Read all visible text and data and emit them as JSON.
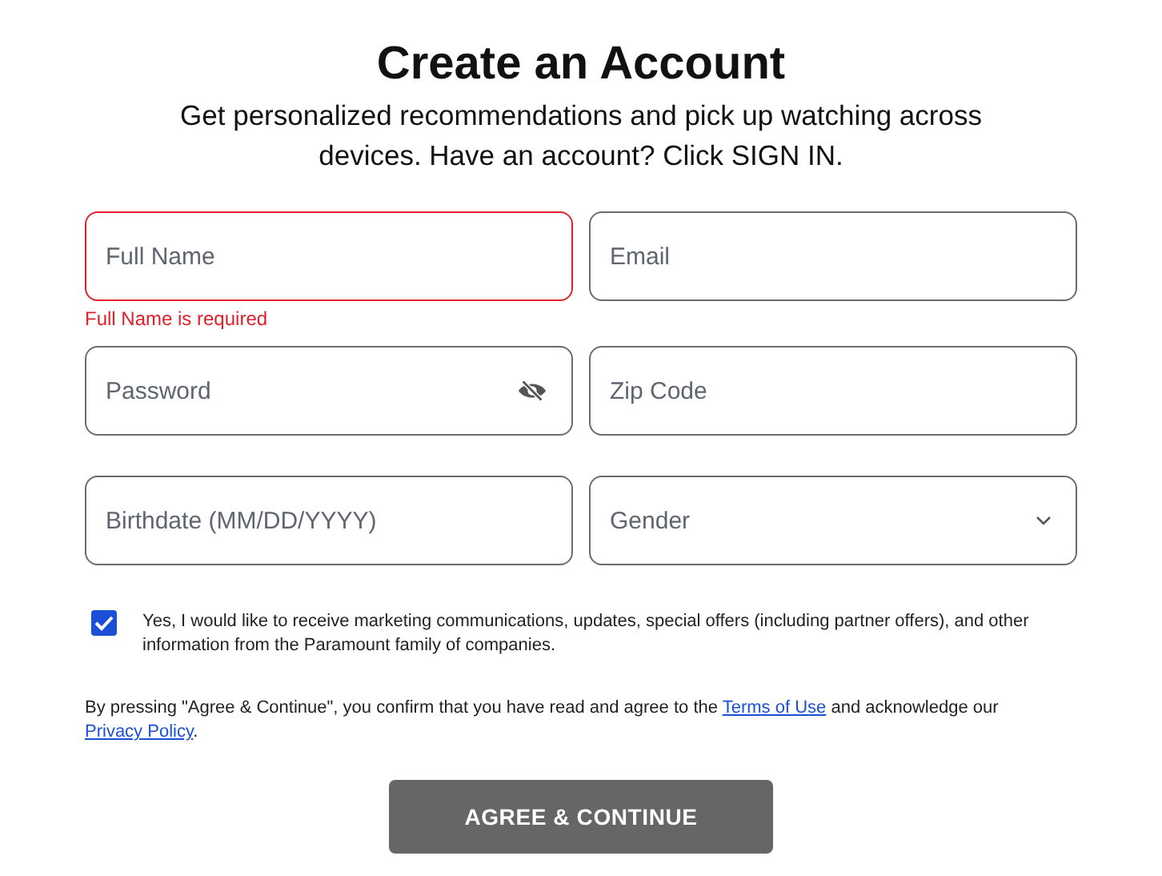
{
  "title": "Create an Account",
  "subtitle": "Get personalized recommendations and pick up watching across devices. Have an account? Click SIGN IN.",
  "fields": [
    {
      "kind": "text",
      "placeholder": "Full Name",
      "error": "Full Name is required"
    },
    {
      "kind": "text",
      "placeholder": "Email"
    },
    {
      "kind": "password",
      "placeholder": "Password"
    },
    {
      "kind": "text",
      "placeholder": "Zip Code"
    },
    {
      "kind": "text",
      "placeholder": "Birthdate (MM/DD/YYYY)"
    },
    {
      "kind": "select",
      "placeholder": "Gender"
    }
  ],
  "consent": {
    "checked": true,
    "label": "Yes, I would like to receive marketing communications, updates, special offers (including partner offers), and other information from the Paramount family of companies."
  },
  "legal": [
    {
      "kind": "text",
      "text": "By pressing \"Agree & Continue\", you confirm that you have read and agree to the "
    },
    {
      "kind": "link",
      "text": "Terms of Use"
    },
    {
      "kind": "text",
      "text": " and acknowledge our "
    },
    {
      "kind": "link",
      "text": "Privacy Policy"
    },
    {
      "kind": "text",
      "text": "."
    }
  ],
  "button": "AGREE & CONTINUE"
}
